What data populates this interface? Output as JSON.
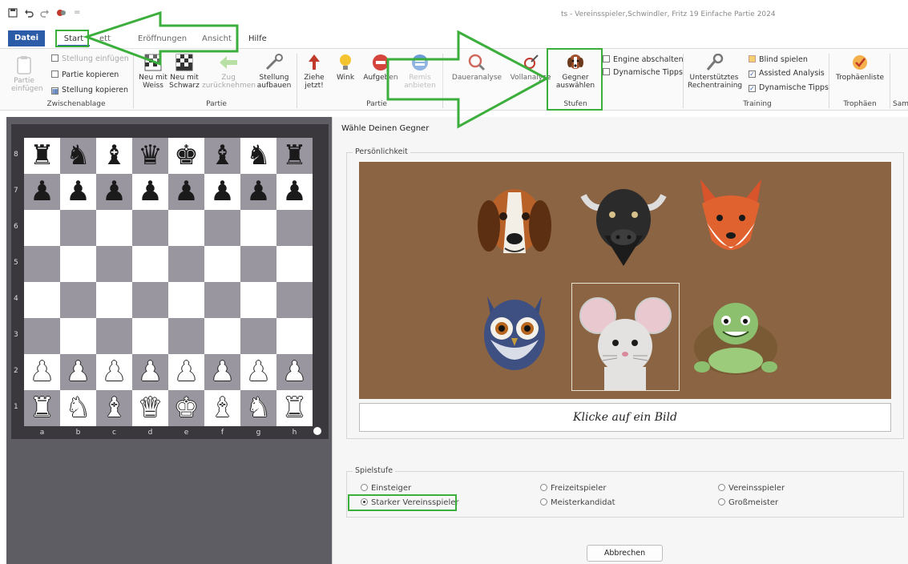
{
  "window": {
    "title": "ts - Vereinsspieler,Schwindler, Fritz 19 Einfache Partie 2024"
  },
  "quick_access": {
    "save_icon": "save-icon",
    "undo_icon": "undo-icon",
    "redo_icon": "redo-icon",
    "app_icon": "fritz-app-icon",
    "dropdown": "="
  },
  "menu": {
    "file": "Datei",
    "tabs": [
      "Start",
      "ett",
      "Eröffnungen",
      "Ansicht",
      "Hilfe"
    ]
  },
  "ribbon": {
    "clipboard": {
      "label": "Zwischenablage",
      "paste_game": [
        "Partie",
        "einfügen"
      ],
      "paste_position": "Stellung einfügen",
      "copy_game": "Partie kopieren",
      "copy_position": "Stellung kopieren"
    },
    "game": {
      "label": "Partie",
      "new_white": [
        "Neu mit",
        "Weiss"
      ],
      "new_black": [
        "Neu mit",
        "Schwarz"
      ],
      "take_back": [
        "Zug",
        "zurücknehmen"
      ],
      "setup": [
        "Stellung",
        "aufbauen"
      ]
    },
    "game2": {
      "label": "Partie",
      "move_now": [
        "Ziehe",
        "jetzt!"
      ],
      "hint": "Wink",
      "resign": "Aufgeben",
      "offer_draw": [
        "Remis",
        "anbieten"
      ]
    },
    "analysis": {
      "infinite": "Daueranalyse",
      "full": "Vollanalyse"
    },
    "levels": {
      "label": "Stufen",
      "choose_opponent": [
        "Gegner",
        "auswählen"
      ],
      "engine_off": "Engine abschalten",
      "dynamic_tips": "Dynamische Tipps"
    },
    "training": {
      "label": "Training",
      "assisted_calc": [
        "Unterstütztes",
        "Rechentraining"
      ],
      "blind": "Blind spielen",
      "assisted_analysis": "Assisted Analysis",
      "dynamic_tips": "Dynamische Tipps"
    },
    "trophies": {
      "label": "Trophäen",
      "list": "Trophäenliste"
    },
    "cut_label": "Sam"
  },
  "board": {
    "ranks": [
      "8",
      "7",
      "6",
      "5",
      "4",
      "3",
      "2",
      "1"
    ],
    "files": [
      "a",
      "b",
      "c",
      "d",
      "e",
      "f",
      "g",
      "h"
    ],
    "rows": [
      [
        "b:♜",
        "b:♞",
        "b:♝",
        "b:♛",
        "b:♚",
        "b:♝",
        "b:♞",
        "b:♜"
      ],
      [
        "b:♟",
        "b:♟",
        "b:♟",
        "b:♟",
        "b:♟",
        "b:♟",
        "b:♟",
        "b:♟"
      ],
      [
        "",
        "",
        "",
        "",
        "",
        "",
        "",
        ""
      ],
      [
        "",
        "",
        "",
        "",
        "",
        "",
        "",
        ""
      ],
      [
        "",
        "",
        "",
        "",
        "",
        "",
        "",
        ""
      ],
      [
        "",
        "",
        "",
        "",
        "",
        "",
        "",
        ""
      ],
      [
        "w:♟",
        "w:♟",
        "w:♟",
        "w:♟",
        "w:♟",
        "w:♟",
        "w:♟",
        "w:♟"
      ],
      [
        "w:♜",
        "w:♞",
        "w:♝",
        "w:♛",
        "w:♚",
        "w:♝",
        "w:♞",
        "w:♜"
      ]
    ]
  },
  "dialog": {
    "title": "Wähle Deinen Gegner",
    "personality_legend": "Persönlichkeit",
    "animals": [
      "beagle",
      "bull",
      "fox",
      "owl",
      "mouse",
      "turtle"
    ],
    "selected_animal": "mouse",
    "click_hint": "Klicke auf ein Bild",
    "level_legend": "Spielstufe",
    "levels": [
      "Einsteiger",
      "Freizeitspieler",
      "Vereinsspieler",
      "Starker Vereinsspieler",
      "Meisterkandidat",
      "Großmeister"
    ],
    "selected_level": "Starker Vereinsspieler",
    "cancel": "Abbrechen"
  },
  "colors": {
    "accent": "#2c5ba8",
    "highlight": "#3cae3c",
    "portrait_bg": "#8a6443",
    "board_dark": "#9a96a0"
  }
}
